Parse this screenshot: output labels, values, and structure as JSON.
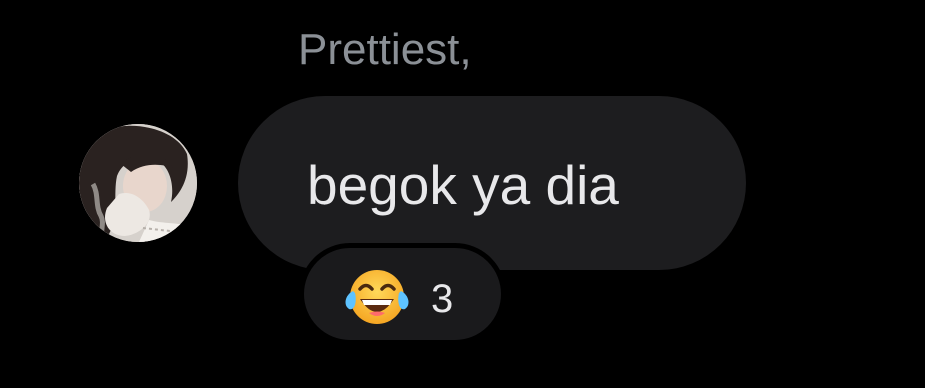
{
  "message": {
    "sender_name": "Prettiest,",
    "text": "begok ya dia",
    "avatar_icon": "user-avatar-photo"
  },
  "reaction": {
    "emoji_icon": "face-with-tears-of-joy-icon",
    "count": "3"
  },
  "colors": {
    "background": "#000000",
    "bubble": "#1d1d1f",
    "sender_name_text": "#8b9096",
    "message_text": "#e8e8ea",
    "reaction_pill": "#1a1a1c"
  }
}
